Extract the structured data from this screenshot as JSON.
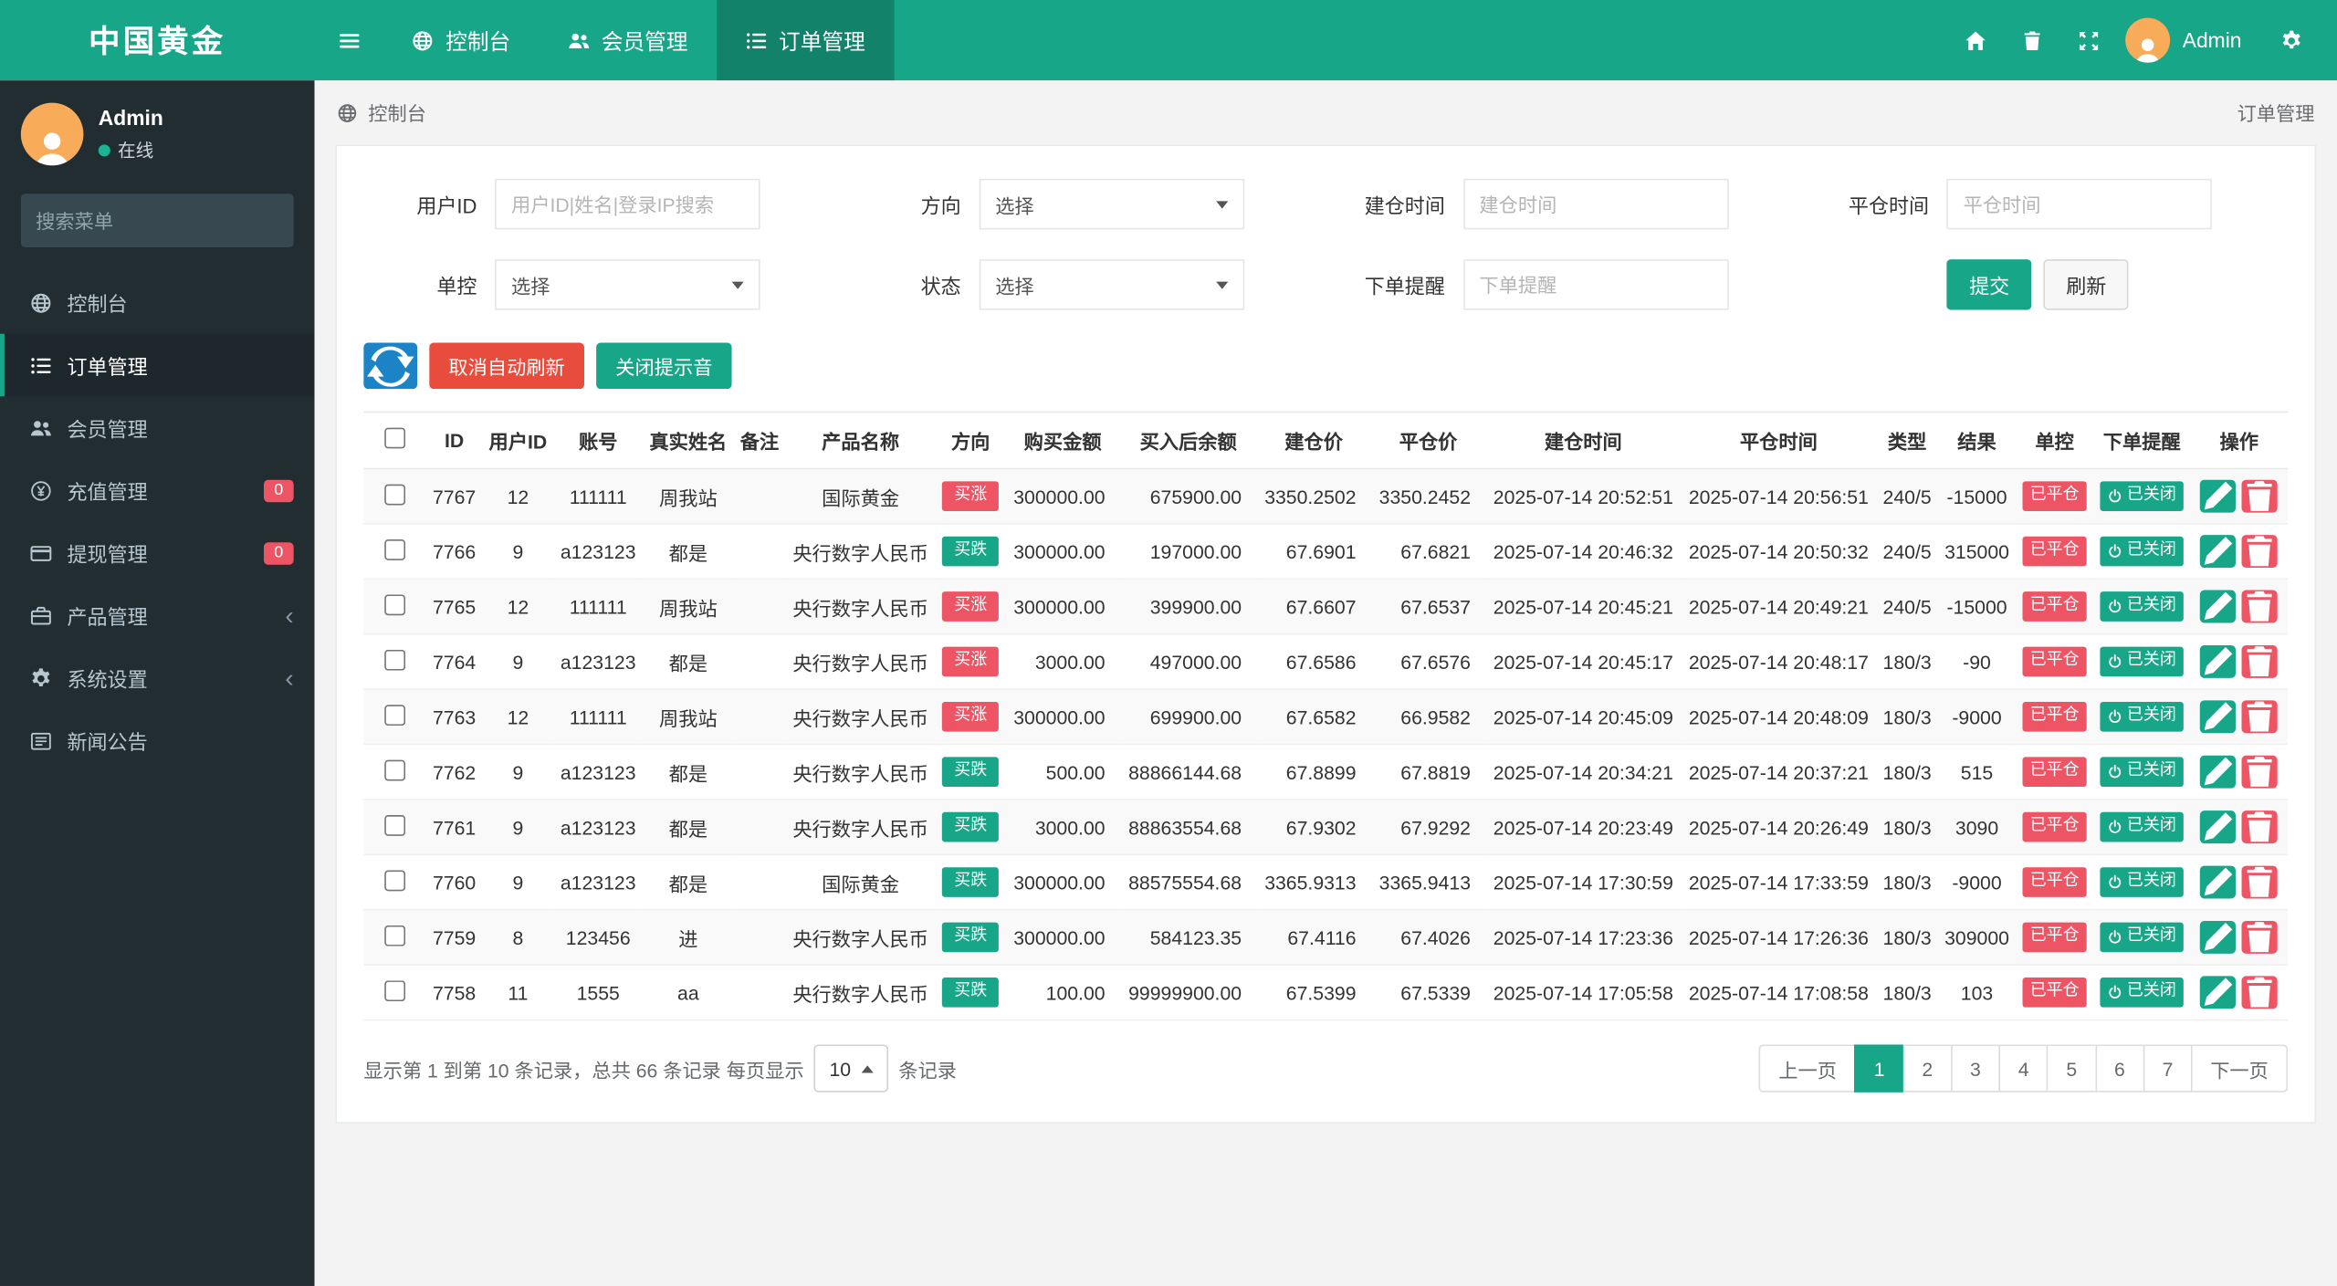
{
  "brand": {
    "logo": "中国黄金"
  },
  "topnav": {
    "tabs": [
      {
        "label": "控制台",
        "icon": "dashboard",
        "active": false
      },
      {
        "label": "会员管理",
        "icon": "users",
        "active": false
      },
      {
        "label": "订单管理",
        "icon": "list",
        "active": true
      }
    ],
    "user": "Admin",
    "right_icons": [
      "home-icon",
      "trash-icon",
      "fullscreen-expand-icon",
      "avatar",
      "gear-icon"
    ]
  },
  "sidebar": {
    "profile": {
      "name": "Admin",
      "status": "在线"
    },
    "search_placeholder": "搜索菜单",
    "search_icon": "search-icon",
    "items": [
      {
        "label": "控制台",
        "icon": "dashboard",
        "active": false
      },
      {
        "label": "订单管理",
        "icon": "list",
        "active": true
      },
      {
        "label": "会员管理",
        "icon": "users",
        "active": false
      },
      {
        "label": "充值管理",
        "icon": "recharge",
        "badge": "0"
      },
      {
        "label": "提现管理",
        "icon": "withdraw",
        "badge": "0"
      },
      {
        "label": "产品管理",
        "icon": "product",
        "chevron": true
      },
      {
        "label": "系统设置",
        "icon": "settings",
        "chevron": true
      },
      {
        "label": "新闻公告",
        "icon": "news"
      }
    ]
  },
  "breadcrumb": {
    "left": "控制台",
    "right": "订单管理"
  },
  "filters": {
    "user_id_label": "用户ID",
    "user_id_placeholder": "用户ID|姓名|登录IP搜索",
    "direction_label": "方向",
    "select_placeholder": "选择",
    "open_time_label": "建仓时间",
    "open_time_placeholder": "建仓时间",
    "close_time_label": "平仓时间",
    "close_time_placeholder": "平仓时间",
    "control_label": "单控",
    "status_label": "状态",
    "remind_label": "下单提醒",
    "remind_placeholder": "下单提醒",
    "submit": "提交",
    "refresh": "刷新"
  },
  "toolbar": {
    "refresh_icon": "refresh-icon",
    "cancel_auto_refresh": "取消自动刷新",
    "close_sound": "关闭提示音"
  },
  "table": {
    "headers": [
      "ID",
      "用户ID",
      "账号",
      "真实姓名",
      "备注",
      "产品名称",
      "方向",
      "购买金额",
      "买入后余额",
      "建仓价",
      "平仓价",
      "建仓时间",
      "平仓时间",
      "类型",
      "结果",
      "单控",
      "下单提醒",
      "操作"
    ],
    "rows": [
      {
        "id": "7767",
        "uid": "12",
        "account": "111111",
        "real_name": "周我站",
        "note": "",
        "product": "国际黄金",
        "direction": "买涨",
        "dir": "up",
        "amount": "300000.00",
        "balance": "675900.00",
        "open_price": "3350.2502",
        "close_price": "3350.2452",
        "open_time": "2025-07-14 20:52:51",
        "close_time": "2025-07-14 20:56:51",
        "type": "240/5",
        "result": "-15000",
        "control": "已平仓",
        "remind": "已关闭"
      },
      {
        "id": "7766",
        "uid": "9",
        "account": "a123123",
        "real_name": "都是",
        "note": "",
        "product": "央行数字人民币",
        "direction": "买跌",
        "dir": "down",
        "amount": "300000.00",
        "balance": "197000.00",
        "open_price": "67.6901",
        "close_price": "67.6821",
        "open_time": "2025-07-14 20:46:32",
        "close_time": "2025-07-14 20:50:32",
        "type": "240/5",
        "result": "315000",
        "control": "已平仓",
        "remind": "已关闭"
      },
      {
        "id": "7765",
        "uid": "12",
        "account": "111111",
        "real_name": "周我站",
        "note": "",
        "product": "央行数字人民币",
        "direction": "买涨",
        "dir": "up",
        "amount": "300000.00",
        "balance": "399900.00",
        "open_price": "67.6607",
        "close_price": "67.6537",
        "open_time": "2025-07-14 20:45:21",
        "close_time": "2025-07-14 20:49:21",
        "type": "240/5",
        "result": "-15000",
        "control": "已平仓",
        "remind": "已关闭"
      },
      {
        "id": "7764",
        "uid": "9",
        "account": "a123123",
        "real_name": "都是",
        "note": "",
        "product": "央行数字人民币",
        "direction": "买涨",
        "dir": "up",
        "amount": "3000.00",
        "balance": "497000.00",
        "open_price": "67.6586",
        "close_price": "67.6576",
        "open_time": "2025-07-14 20:45:17",
        "close_time": "2025-07-14 20:48:17",
        "type": "180/3",
        "result": "-90",
        "control": "已平仓",
        "remind": "已关闭"
      },
      {
        "id": "7763",
        "uid": "12",
        "account": "111111",
        "real_name": "周我站",
        "note": "",
        "product": "央行数字人民币",
        "direction": "买涨",
        "dir": "up",
        "amount": "300000.00",
        "balance": "699900.00",
        "open_price": "67.6582",
        "close_price": "66.9582",
        "open_time": "2025-07-14 20:45:09",
        "close_time": "2025-07-14 20:48:09",
        "type": "180/3",
        "result": "-9000",
        "control": "已平仓",
        "remind": "已关闭"
      },
      {
        "id": "7762",
        "uid": "9",
        "account": "a123123",
        "real_name": "都是",
        "note": "",
        "product": "央行数字人民币",
        "direction": "买跌",
        "dir": "down",
        "amount": "500.00",
        "balance": "88866144.68",
        "open_price": "67.8899",
        "close_price": "67.8819",
        "open_time": "2025-07-14 20:34:21",
        "close_time": "2025-07-14 20:37:21",
        "type": "180/3",
        "result": "515",
        "control": "已平仓",
        "remind": "已关闭"
      },
      {
        "id": "7761",
        "uid": "9",
        "account": "a123123",
        "real_name": "都是",
        "note": "",
        "product": "央行数字人民币",
        "direction": "买跌",
        "dir": "down",
        "amount": "3000.00",
        "balance": "88863554.68",
        "open_price": "67.9302",
        "close_price": "67.9292",
        "open_time": "2025-07-14 20:23:49",
        "close_time": "2025-07-14 20:26:49",
        "type": "180/3",
        "result": "3090",
        "control": "已平仓",
        "remind": "已关闭"
      },
      {
        "id": "7760",
        "uid": "9",
        "account": "a123123",
        "real_name": "都是",
        "note": "",
        "product": "国际黄金",
        "direction": "买跌",
        "dir": "down",
        "amount": "300000.00",
        "balance": "88575554.68",
        "open_price": "3365.9313",
        "close_price": "3365.9413",
        "open_time": "2025-07-14 17:30:59",
        "close_time": "2025-07-14 17:33:59",
        "type": "180/3",
        "result": "-9000",
        "control": "已平仓",
        "remind": "已关闭"
      },
      {
        "id": "7759",
        "uid": "8",
        "account": "123456",
        "real_name": "进",
        "note": "",
        "product": "央行数字人民币",
        "direction": "买跌",
        "dir": "down",
        "amount": "300000.00",
        "balance": "584123.35",
        "open_price": "67.4116",
        "close_price": "67.4026",
        "open_time": "2025-07-14 17:23:36",
        "close_time": "2025-07-14 17:26:36",
        "type": "180/3",
        "result": "309000",
        "control": "已平仓",
        "remind": "已关闭"
      },
      {
        "id": "7758",
        "uid": "11",
        "account": "1555",
        "real_name": "aa",
        "note": "",
        "product": "央行数字人民币",
        "direction": "买跌",
        "dir": "down",
        "amount": "100.00",
        "balance": "99999900.00",
        "open_price": "67.5399",
        "close_price": "67.5339",
        "open_time": "2025-07-14 17:05:58",
        "close_time": "2025-07-14 17:08:58",
        "type": "180/3",
        "result": "103",
        "control": "已平仓",
        "remind": "已关闭"
      }
    ]
  },
  "footer": {
    "summary_prefix": "显示第 1 到第 10 条记录，总共 66 条记录 每页显示",
    "page_size": "10",
    "summary_suffix": "条记录",
    "prev": "上一页",
    "next": "下一页",
    "pages": [
      "1",
      "2",
      "3",
      "4",
      "5",
      "6",
      "7"
    ],
    "active_page": "1"
  },
  "colors": {
    "brand_teal": "#18a689",
    "active_tab_teal": "#12826a",
    "sidebar_bg": "#222d32",
    "sidebar_active_bg": "#1e282c",
    "badge_red": "#ed5565",
    "badge_green": "#18a689",
    "button_blue": "#1c84c6",
    "button_red": "#e74c3c",
    "page_bg": "#f3f3f4"
  }
}
